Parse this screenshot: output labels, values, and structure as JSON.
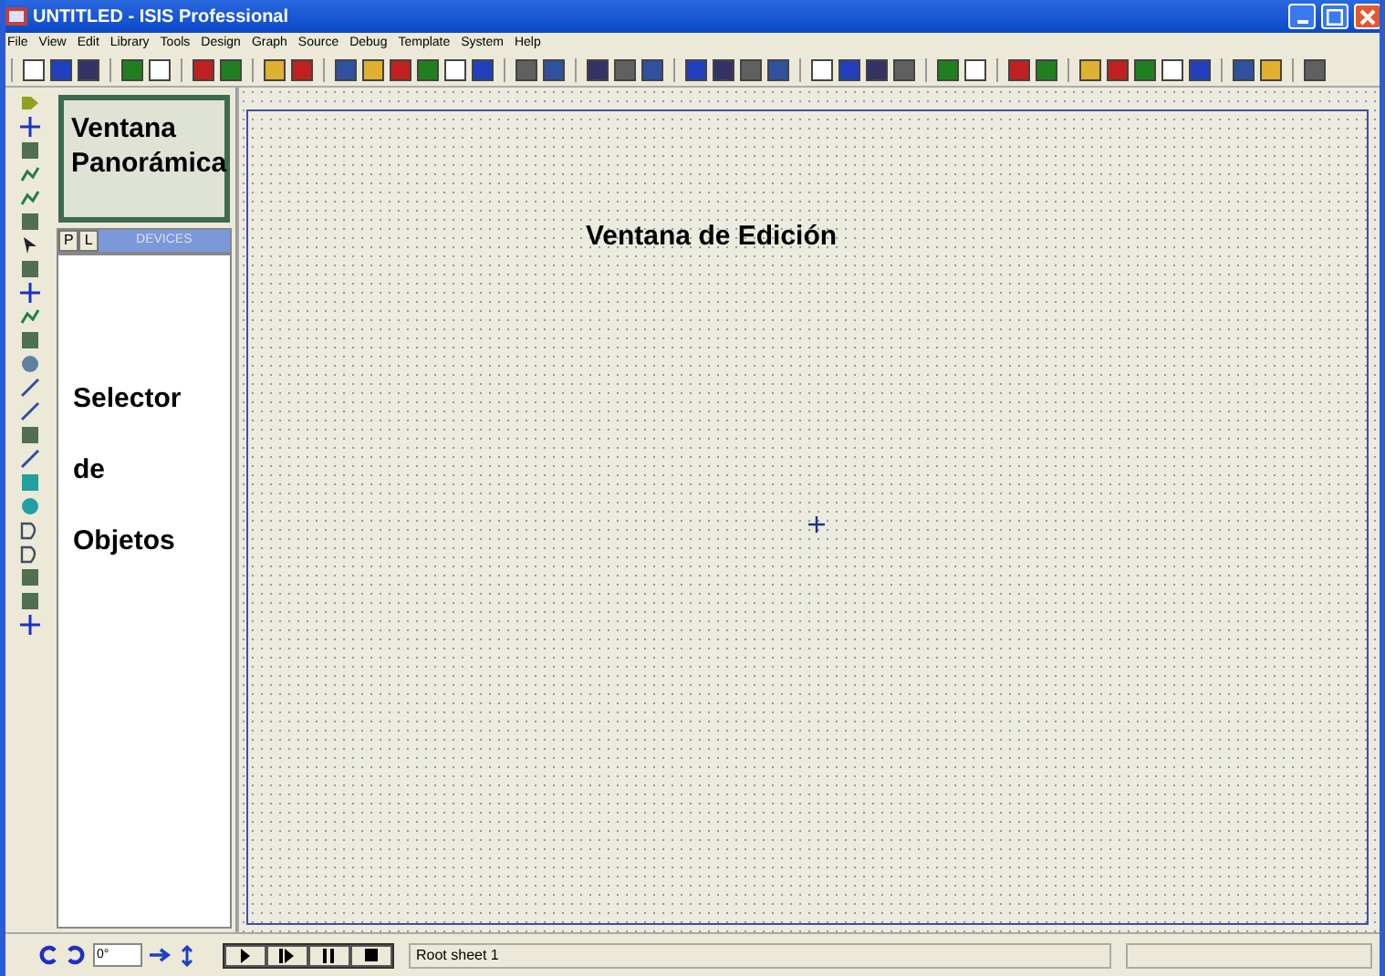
{
  "window": {
    "title": "UNTITLED - ISIS Professional"
  },
  "menu": [
    "File",
    "View",
    "Edit",
    "Library",
    "Tools",
    "Design",
    "Graph",
    "Source",
    "Debug",
    "Template",
    "System",
    "Help"
  ],
  "overview": {
    "label": "Ventana Panorámica"
  },
  "selector": {
    "tabs": [
      "P",
      "L"
    ],
    "header": "DEVICES",
    "labels": [
      "Selector",
      "de",
      "Objetos"
    ]
  },
  "canvas": {
    "label": "Ventana de Edición"
  },
  "rotation": {
    "value": "0°"
  },
  "status": {
    "sheet": "Root sheet 1"
  }
}
